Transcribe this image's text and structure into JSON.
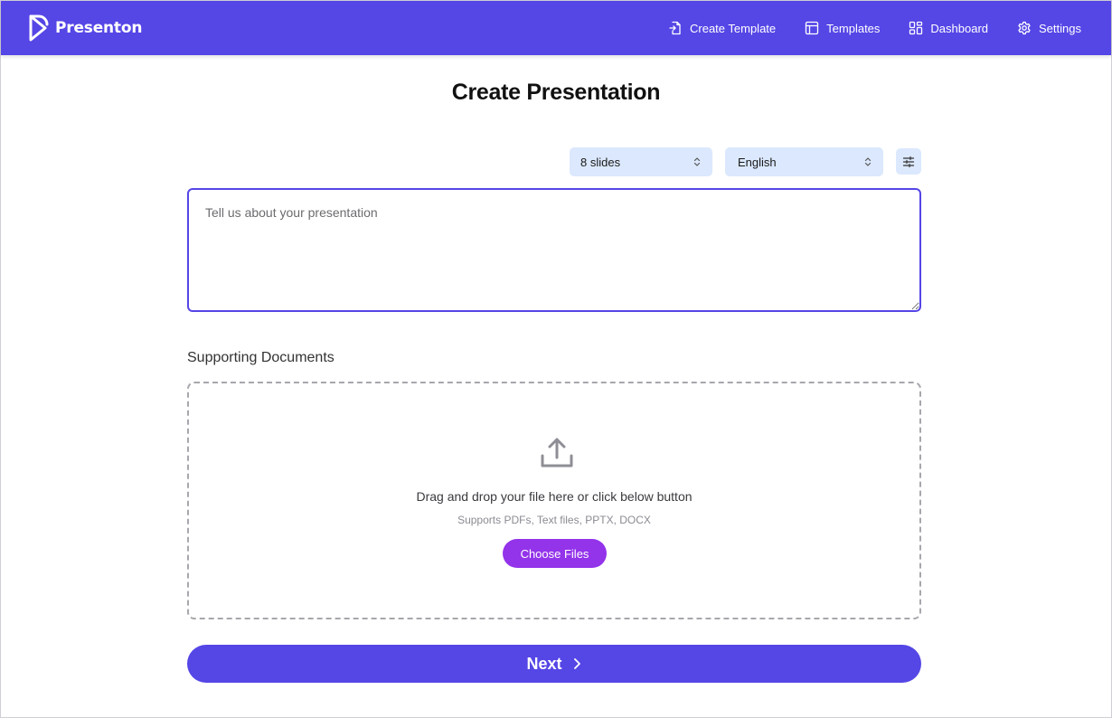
{
  "header": {
    "brand": "Presenton",
    "nav": [
      {
        "label": "Create Template",
        "icon": "file-import-icon"
      },
      {
        "label": "Templates",
        "icon": "layout-icon"
      },
      {
        "label": "Dashboard",
        "icon": "grid-icon"
      },
      {
        "label": "Settings",
        "icon": "gear-icon"
      }
    ]
  },
  "main": {
    "title": "Create Presentation",
    "slides_select": {
      "value": "8 slides"
    },
    "language_select": {
      "value": "English"
    },
    "prompt": {
      "placeholder": "Tell us about your presentation",
      "value": ""
    },
    "supporting_label": "Supporting Documents",
    "dropzone": {
      "text": "Drag and drop your file here or click below button",
      "hint": "Supports PDFs, Text files, PPTX, DOCX",
      "button": "Choose Files"
    },
    "next_label": "Next"
  },
  "colors": {
    "primary": "#5546e6",
    "select_bg": "#dbe8fd",
    "choose_button": "#9333ea"
  }
}
